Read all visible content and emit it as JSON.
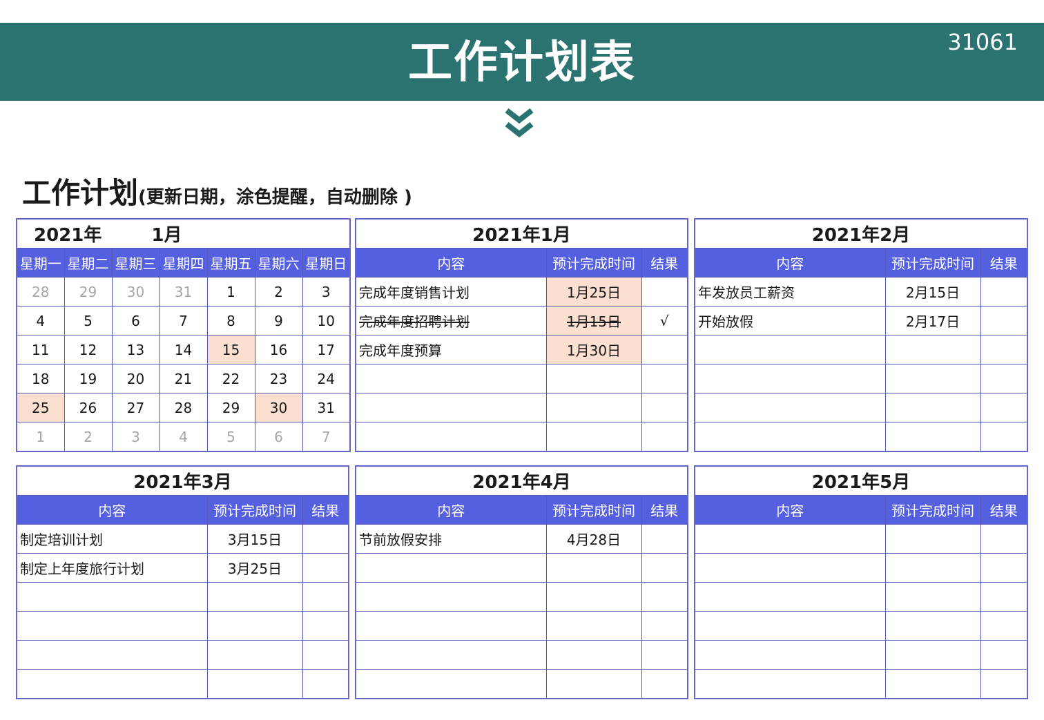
{
  "banner": {
    "title": "工作计划表",
    "code": "31061"
  },
  "section": {
    "title": "工作计划",
    "note": "(更新日期，涂色提醒，自动删除 )"
  },
  "calendar": {
    "year_label": "2021年",
    "month_label": "1月",
    "weekdays": [
      "星期一",
      "星期二",
      "星期三",
      "星期四",
      "星期五",
      "星期六",
      "星期日"
    ],
    "rows": [
      [
        "28",
        "29",
        "30",
        "31",
        "1",
        "2",
        "3"
      ],
      [
        "4",
        "5",
        "6",
        "7",
        "8",
        "9",
        "10"
      ],
      [
        "11",
        "12",
        "13",
        "14",
        "15",
        "16",
        "17"
      ],
      [
        "18",
        "19",
        "20",
        "21",
        "22",
        "23",
        "24"
      ],
      [
        "25",
        "26",
        "27",
        "28",
        "29",
        "30",
        "31"
      ],
      [
        "1",
        "2",
        "3",
        "4",
        "5",
        "6",
        "7"
      ]
    ]
  },
  "columns": {
    "content": "内容",
    "due": "预计完成时间",
    "result": "结果"
  },
  "months": [
    {
      "title": "2021年1月",
      "rows": [
        {
          "content": "完成年度销售计划",
          "due": "1月25日",
          "result": ""
        },
        {
          "content": "完成年度招聘计划",
          "due": "1月15日",
          "result": "√"
        },
        {
          "content": "完成年度预算",
          "due": "1月30日",
          "result": ""
        },
        {
          "content": "",
          "due": "",
          "result": ""
        },
        {
          "content": "",
          "due": "",
          "result": ""
        },
        {
          "content": "",
          "due": "",
          "result": ""
        }
      ]
    },
    {
      "title": "2021年2月",
      "rows": [
        {
          "content": "年发放员工薪资",
          "due": "2月15日",
          "result": ""
        },
        {
          "content": "开始放假",
          "due": "2月17日",
          "result": ""
        },
        {
          "content": "",
          "due": "",
          "result": ""
        },
        {
          "content": "",
          "due": "",
          "result": ""
        },
        {
          "content": "",
          "due": "",
          "result": ""
        },
        {
          "content": "",
          "due": "",
          "result": ""
        }
      ]
    },
    {
      "title": "2021年3月",
      "rows": [
        {
          "content": "制定培训计划",
          "due": "3月15日",
          "result": ""
        },
        {
          "content": "制定上年度旅行计划",
          "due": "3月25日",
          "result": ""
        },
        {
          "content": "",
          "due": "",
          "result": ""
        },
        {
          "content": "",
          "due": "",
          "result": ""
        },
        {
          "content": "",
          "due": "",
          "result": ""
        },
        {
          "content": "",
          "due": "",
          "result": ""
        }
      ]
    },
    {
      "title": "2021年4月",
      "rows": [
        {
          "content": "节前放假安排",
          "due": "4月28日",
          "result": ""
        },
        {
          "content": "",
          "due": "",
          "result": ""
        },
        {
          "content": "",
          "due": "",
          "result": ""
        },
        {
          "content": "",
          "due": "",
          "result": ""
        },
        {
          "content": "",
          "due": "",
          "result": ""
        },
        {
          "content": "",
          "due": "",
          "result": ""
        }
      ]
    },
    {
      "title": "2021年5月",
      "rows": [
        {
          "content": "",
          "due": "",
          "result": ""
        },
        {
          "content": "",
          "due": "",
          "result": ""
        },
        {
          "content": "",
          "due": "",
          "result": ""
        },
        {
          "content": "",
          "due": "",
          "result": ""
        },
        {
          "content": "",
          "due": "",
          "result": ""
        },
        {
          "content": "",
          "due": "",
          "result": ""
        }
      ]
    }
  ],
  "colors": {
    "banner": "#2b7370",
    "header": "#5460e0",
    "highlight": "#fbe0d2",
    "border": "#5457b8"
  },
  "icons": {
    "chevron": "double-chevron-down-icon"
  }
}
